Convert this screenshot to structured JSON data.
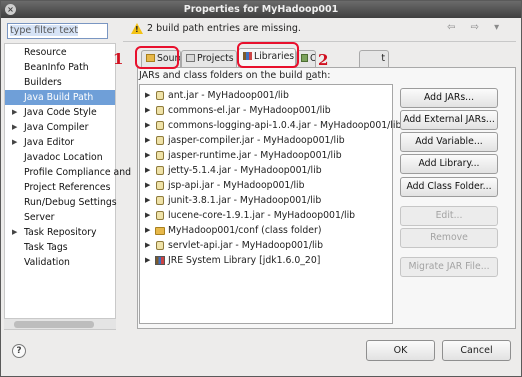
{
  "window": {
    "title": "Properties for MyHadoop001",
    "close_glyph": "×"
  },
  "filter": {
    "placeholder": "type filter text"
  },
  "nav": {
    "items": [
      {
        "label": "Resource",
        "expand": ""
      },
      {
        "label": "BeanInfo Path",
        "expand": ""
      },
      {
        "label": "Builders",
        "expand": ""
      },
      {
        "label": "Java Build Path",
        "expand": "",
        "selected": true
      },
      {
        "label": "Java Code Style",
        "expand": "▶"
      },
      {
        "label": "Java Compiler",
        "expand": "▶"
      },
      {
        "label": "Java Editor",
        "expand": "▶"
      },
      {
        "label": "Javadoc Location",
        "expand": ""
      },
      {
        "label": "Profile Compliance and",
        "expand": ""
      },
      {
        "label": "Project References",
        "expand": ""
      },
      {
        "label": "Run/Debug Settings",
        "expand": ""
      },
      {
        "label": "Server",
        "expand": ""
      },
      {
        "label": "Task Repository",
        "expand": "▶"
      },
      {
        "label": "Task Tags",
        "expand": ""
      },
      {
        "label": "Validation",
        "expand": ""
      }
    ]
  },
  "header": {
    "message": "2 build path entries are missing.",
    "nav_arrows": "⇦ ⇨ ▾"
  },
  "tabs": [
    {
      "label": "Source"
    },
    {
      "label": "Projects"
    },
    {
      "label": "Libraries",
      "active": true
    },
    {
      "label": "O"
    },
    {
      "label": "t"
    }
  ],
  "libraries": {
    "caption_pre": "JARs and class folders on the build ",
    "caption_underline": "p",
    "caption_post": "ath:",
    "entries": [
      {
        "label": "ant.jar - MyHadoop001/lib",
        "kind": "jar"
      },
      {
        "label": "commons-el.jar - MyHadoop001/lib",
        "kind": "jar"
      },
      {
        "label": "commons-logging-api-1.0.4.jar - MyHadoop001/lib",
        "kind": "jar"
      },
      {
        "label": "jasper-compiler.jar - MyHadoop001/lib",
        "kind": "jar"
      },
      {
        "label": "jasper-runtime.jar - MyHadoop001/lib",
        "kind": "jar"
      },
      {
        "label": "jetty-5.1.4.jar - MyHadoop001/lib",
        "kind": "jar"
      },
      {
        "label": "jsp-api.jar - MyHadoop001/lib",
        "kind": "jar"
      },
      {
        "label": "junit-3.8.1.jar - MyHadoop001/lib",
        "kind": "jar"
      },
      {
        "label": "lucene-core-1.9.1.jar - MyHadoop001/lib",
        "kind": "jar"
      },
      {
        "label": "MyHadoop001/conf (class folder)",
        "kind": "folder"
      },
      {
        "label": "servlet-api.jar - MyHadoop001/lib",
        "kind": "jar"
      },
      {
        "label": "JRE System Library [jdk1.6.0_20]",
        "kind": "library"
      }
    ],
    "buttons": [
      {
        "label": "Add JARs...",
        "enabled": true
      },
      {
        "label": "Add External JARs...",
        "enabled": true
      },
      {
        "label": "Add Variable...",
        "enabled": true
      },
      {
        "label": "Add Library...",
        "enabled": true
      },
      {
        "label": "Add Class Folder...",
        "enabled": true
      },
      {
        "label": "Edit...",
        "enabled": false
      },
      {
        "label": "Remove",
        "enabled": false
      },
      {
        "label": "Migrate JAR File...",
        "enabled": false
      }
    ]
  },
  "annotations": {
    "one": "1",
    "two": "2"
  },
  "footer": {
    "help": "?",
    "ok": "OK",
    "cancel": "Cancel"
  },
  "colors": {
    "selection": "#6f9fd8",
    "annotation": "#e8102d",
    "warning": "#f3c214"
  }
}
